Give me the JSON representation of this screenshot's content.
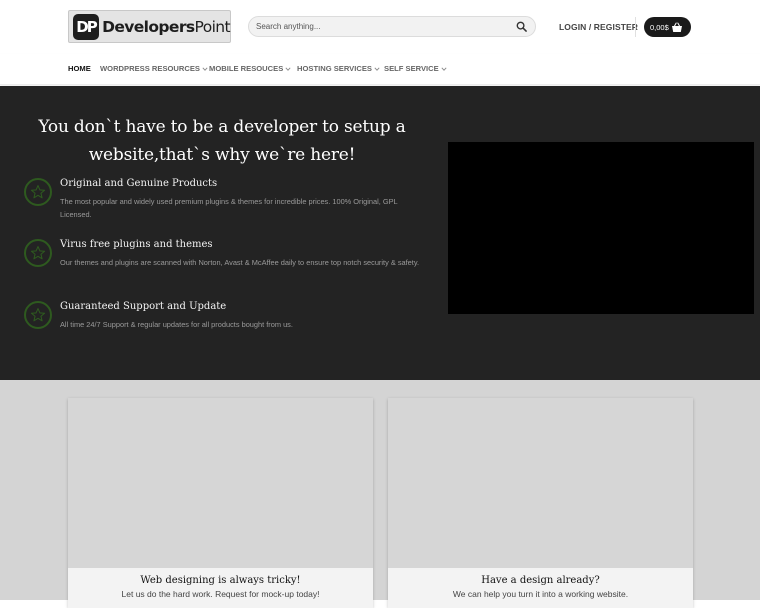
{
  "header": {
    "logo_mark": "DP",
    "logo_bold": "Developers",
    "logo_light": "Point",
    "search": {
      "placeholder": "Search anything..."
    },
    "login_label": "LOGIN / REGISTER",
    "cart_total": "0,00$",
    "icons": {
      "search": "search-icon",
      "cart": "basket-icon"
    }
  },
  "nav": {
    "items": [
      {
        "label": "HOME",
        "active": true,
        "dropdown": false
      },
      {
        "label": "WORDPRESS RESOURCES",
        "active": false,
        "dropdown": true
      },
      {
        "label": "MOBILE RESOUCES",
        "active": false,
        "dropdown": true
      },
      {
        "label": "HOSTING SERVICES",
        "active": false,
        "dropdown": true
      },
      {
        "label": "SELF SERVICE",
        "active": false,
        "dropdown": true
      }
    ]
  },
  "hero": {
    "title_line1": "You don`t have to be a developer to setup a",
    "title_line2": "website,that`s why we`re here!",
    "features": [
      {
        "icon": "star-icon",
        "title": "Original and Genuine Products",
        "desc": "The most popular and widely used premium plugins & themes for incredible prices. 100% Original, GPL Licensed."
      },
      {
        "icon": "star-icon",
        "title": "Virus free plugins and themes",
        "desc": "Our themes and plugins are scanned with Norton, Avast & McAffee daily to ensure top notch security & safety."
      },
      {
        "icon": "star-icon",
        "title": "Guaranteed Support and Update",
        "desc": "All time 24/7 Support & regular updates for all products bought from us."
      }
    ]
  },
  "cards": [
    {
      "title": "Web designing is always tricky!",
      "subtitle": "Let us do the hard work. Request for mock-up today!"
    },
    {
      "title": "Have a design already?",
      "subtitle": "We can help you turn it into a working website."
    }
  ],
  "colors": {
    "hero_bg": "#232323",
    "accent_green": "#2e5a1f",
    "cart_bg": "#1a1a1a",
    "cards_bg": "#d4d4d4"
  }
}
